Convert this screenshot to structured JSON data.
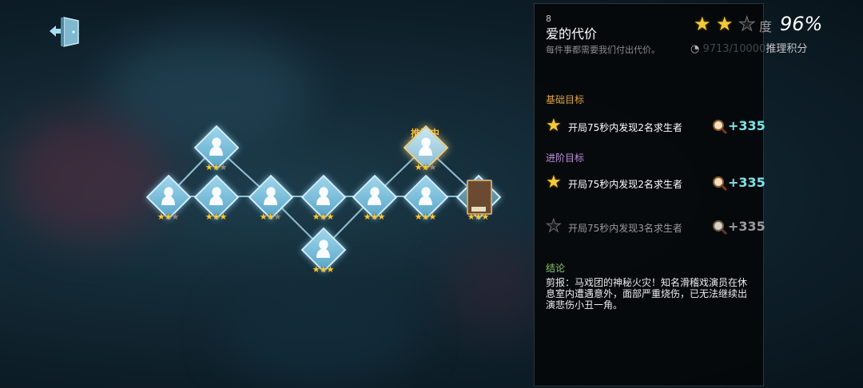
{
  "case": {
    "number": "8",
    "title": "爱的代价",
    "subtitle": "每件事都需要我们付出代价。"
  },
  "progress": {
    "stars_earned": 2,
    "stars_total": 3,
    "label_fragment": "度",
    "percent": "96%",
    "score_value": "9713/10000",
    "score_label": "推理积分"
  },
  "sections": {
    "basic": "基础目标",
    "advanced": "进阶目标",
    "conclusion": "结论"
  },
  "tasks": {
    "basic": [
      {
        "text": "开局75秒内发现2名求生者",
        "points": "+335",
        "done": true
      }
    ],
    "advanced": [
      {
        "text": "开局75秒内发现2名求生者",
        "points": "+335",
        "done": true
      },
      {
        "text": "开局75秒内发现3名求生者",
        "points": "+335",
        "done": false
      }
    ]
  },
  "conclusion_text": "剪报：马戏团的神秘火灾！知名滑稽戏演员在休息室内遭遇意外，面部严重烧伤，已无法继续出演悲伤小丑一角。",
  "map": {
    "active_status": "推演中",
    "nodes": [
      {
        "id": "n1",
        "stars": 2
      },
      {
        "id": "n2",
        "stars": 2
      },
      {
        "id": "n3",
        "stars": 3
      },
      {
        "id": "n4",
        "stars": 2
      },
      {
        "id": "n5",
        "stars": 3
      },
      {
        "id": "n6",
        "stars": 3
      },
      {
        "id": "n7",
        "stars": 3
      },
      {
        "id": "n8",
        "stars": 3
      },
      {
        "id": "n9",
        "stars": 2,
        "active": true
      },
      {
        "id": "n10",
        "stars": 3
      }
    ]
  },
  "colors": {
    "star": "#f5c93a",
    "points": "#7ee4e8",
    "basic": "#e0a548",
    "advanced": "#c08ed8",
    "conclusion": "#86c86a"
  }
}
